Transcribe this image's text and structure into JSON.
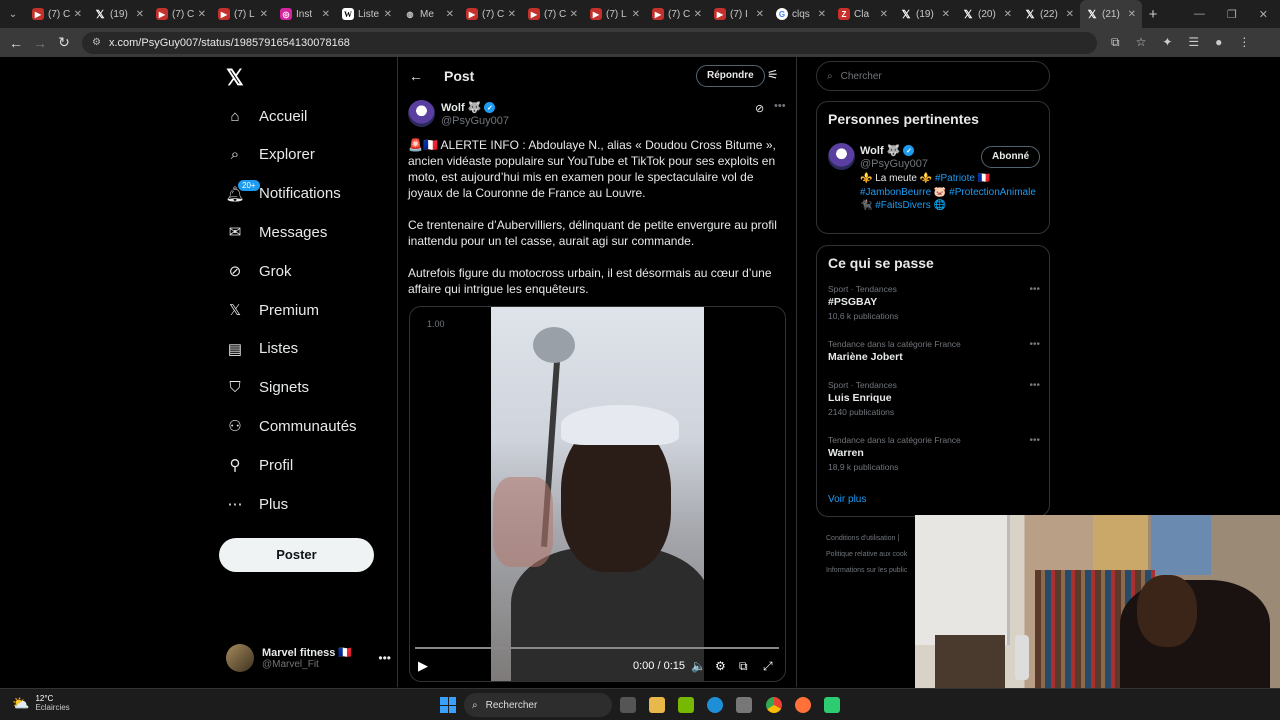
{
  "browser": {
    "tabs": [
      {
        "favicon": "youtube-icon",
        "title": "(7) C"
      },
      {
        "favicon": "x-icon",
        "title": "(19)"
      },
      {
        "favicon": "youtube-icon",
        "title": "(7) C"
      },
      {
        "favicon": "youtube-icon",
        "title": "(7) L"
      },
      {
        "favicon": "instagram-icon",
        "title": "Inst"
      },
      {
        "favicon": "wikipedia-icon",
        "title": "Liste"
      },
      {
        "favicon": "meta-icon",
        "title": "Me"
      },
      {
        "favicon": "youtube-icon",
        "title": "(7) C"
      },
      {
        "favicon": "youtube-icon",
        "title": "(7) C"
      },
      {
        "favicon": "youtube-icon",
        "title": "(7) L"
      },
      {
        "favicon": "youtube-icon",
        "title": "(7) C"
      },
      {
        "favicon": "youtube-icon",
        "title": "(7) I"
      },
      {
        "favicon": "google-icon",
        "title": "clqs"
      },
      {
        "favicon": "z-icon",
        "title": "Cla"
      },
      {
        "favicon": "x-icon",
        "title": "(19)"
      },
      {
        "favicon": "x-icon",
        "title": "(20)"
      },
      {
        "favicon": "x-icon",
        "title": "(22)"
      },
      {
        "favicon": "x-icon",
        "title": "(21)"
      }
    ],
    "url": "x.com/PsyGuy007/status/1985791654130078168"
  },
  "nav": {
    "items": [
      {
        "label": "Accueil",
        "icon": "home-icon"
      },
      {
        "label": "Explorer",
        "icon": "search-icon"
      },
      {
        "label": "Notifications",
        "icon": "bell-icon",
        "badge": "20+"
      },
      {
        "label": "Messages",
        "icon": "mail-icon"
      },
      {
        "label": "Grok",
        "icon": "grok-icon"
      },
      {
        "label": "Premium",
        "icon": "x-logo-icon"
      },
      {
        "label": "Listes",
        "icon": "list-icon"
      },
      {
        "label": "Signets",
        "icon": "bookmark-icon"
      },
      {
        "label": "Communautés",
        "icon": "communities-icon"
      },
      {
        "label": "Profil",
        "icon": "person-icon"
      },
      {
        "label": "Plus",
        "icon": "more-circle-icon"
      }
    ],
    "post_button": "Poster",
    "account": {
      "name": "Marvel fitness 🇫🇷",
      "handle": "@Marvel_Fit"
    }
  },
  "post": {
    "header_title": "Post",
    "reply_button": "Répondre",
    "author_name": "Wolf 🐺",
    "author_handle": "@PsyGuy007",
    "paragraphs": [
      "🚨🇫🇷 ALERTE INFO : Abdoulaye N., alias « Doudou Cross Bitume », ancien vidéaste populaire sur YouTube et TikTok pour ses exploits en moto, est aujourd’hui mis en examen pour le spectaculaire vol de joyaux de la Couronne de France au Louvre.",
      "Ce trentenaire d’Aubervilliers, délinquant de petite envergure au profil inattendu pour un tel casse, aurait agi sur commande.",
      "Autrefois figure du motocross urbain, il est désormais au cœur d’une affaire qui intrigue les enquêteurs."
    ],
    "video": {
      "speed": "1.00",
      "time": "0:00 / 0:15",
      "progress": 0
    }
  },
  "sidebar": {
    "search_placeholder": "Chercher",
    "relevant": {
      "title": "Personnes pertinentes",
      "name": "Wolf 🐺",
      "handle": "@PsyGuy007",
      "follow_label": "Abonné",
      "bio_prefix": "⚜️ La meute ⚜️ ",
      "bio_tag1": "#Patriote",
      "bio_mid1": " 🇫🇷 ",
      "bio_tag2": "#JambonBeurre",
      "bio_mid2": " 🐷 ",
      "bio_tag3": "#ProtectionAnimale",
      "bio_mid3": " 🐈‍⬛ ",
      "bio_tag4": "#FaitsDivers",
      "bio_suffix": " 🌐"
    },
    "trends": {
      "title": "Ce qui se passe",
      "items": [
        {
          "meta": "Sport · Tendances",
          "name": "#PSGBAY",
          "count": "10,6 k publications"
        },
        {
          "meta": "Tendance dans la catégorie France",
          "name": "Mariène Jobert",
          "count": ""
        },
        {
          "meta": "Sport · Tendances",
          "name": "Luis Enrique",
          "count": "2140 publications"
        },
        {
          "meta": "Tendance dans la catégorie France",
          "name": "Warren",
          "count": "18,9 k publications"
        }
      ],
      "see_more": "Voir plus"
    },
    "footer": [
      "Conditions d'utilisation  |",
      "Politique relative aux cook",
      "Informations sur les public"
    ]
  },
  "taskbar": {
    "temp": "12°C",
    "weather": "Eclaircies",
    "search": "Rechercher"
  }
}
